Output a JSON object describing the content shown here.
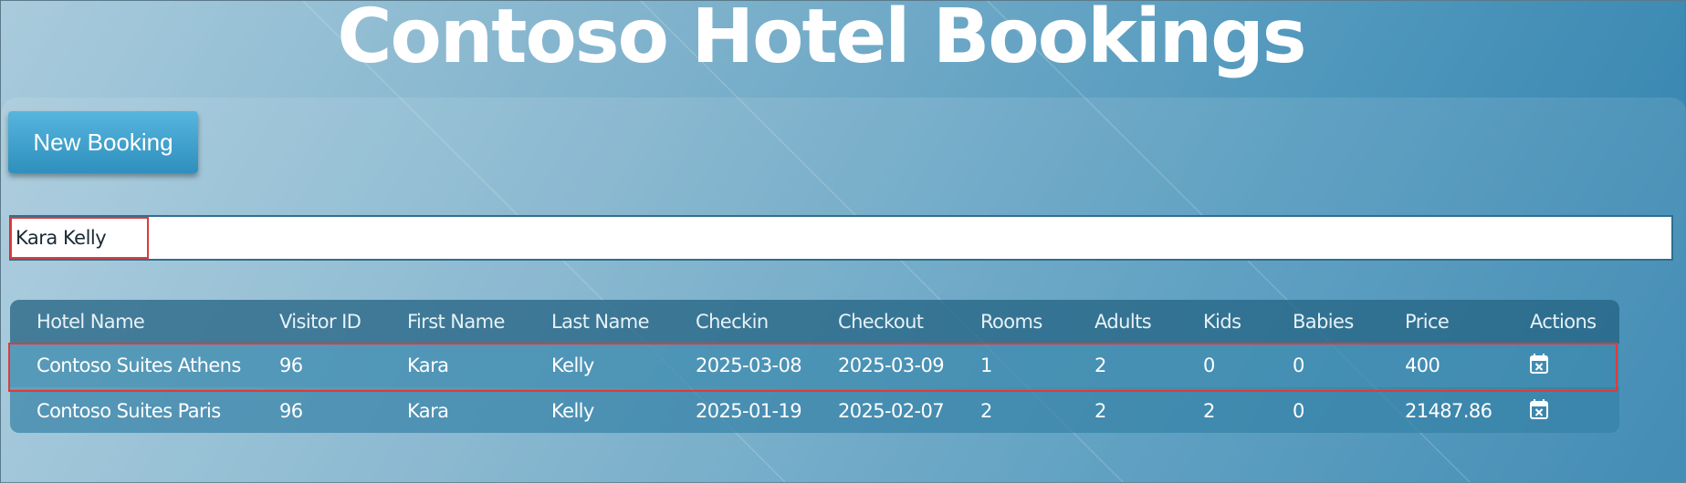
{
  "header": {
    "title": "Contoso Hotel Bookings"
  },
  "toolbar": {
    "new_booking_label": "New Booking"
  },
  "search": {
    "value": "Kara Kelly"
  },
  "table": {
    "columns": [
      "Hotel Name",
      "Visitor ID",
      "First Name",
      "Last Name",
      "Checkin",
      "Checkout",
      "Rooms",
      "Adults",
      "Kids",
      "Babies",
      "Price",
      "Actions"
    ],
    "rows": [
      {
        "hotel": "Contoso Suites Athens",
        "visitor_id": "96",
        "first": "Kara",
        "last": "Kelly",
        "checkin": "2025-03-08",
        "checkout": "2025-03-09",
        "rooms": "1",
        "adults": "2",
        "kids": "0",
        "babies": "0",
        "price": "400",
        "action_icon": "calendar-cancel-icon"
      },
      {
        "hotel": "Contoso Suites Paris",
        "visitor_id": "96",
        "first": "Kara",
        "last": "Kelly",
        "checkin": "2025-01-19",
        "checkout": "2025-02-07",
        "rooms": "2",
        "adults": "2",
        "kids": "2",
        "babies": "0",
        "price": "21487.86",
        "action_icon": "calendar-cancel-icon"
      }
    ]
  },
  "colors": {
    "accent": "#2f8fbd",
    "highlight": "#e03a3a"
  }
}
